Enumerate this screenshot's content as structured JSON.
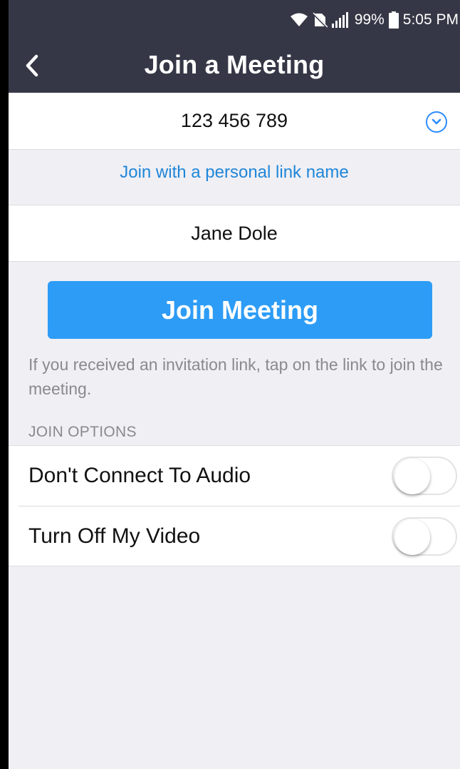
{
  "status_bar": {
    "battery_percent": "99%",
    "time": "5:05 PM"
  },
  "header": {
    "title": "Join a Meeting"
  },
  "meeting_id": {
    "value": "123 456 789"
  },
  "personal_link": {
    "label": "Join with a personal link name"
  },
  "display_name": {
    "value": "Jane Dole"
  },
  "join_button": {
    "label": "Join Meeting"
  },
  "hint": {
    "text": "If you received an invitation link, tap on the link to join the meeting."
  },
  "join_options": {
    "header": "JOIN OPTIONS",
    "items": [
      {
        "label": "Don't Connect To Audio",
        "enabled": false
      },
      {
        "label": "Turn Off My Video",
        "enabled": false
      }
    ]
  },
  "colors": {
    "topbar": "#363746",
    "accent": "#2d9cf6",
    "link": "#1f86d8",
    "background": "#efeff4"
  }
}
